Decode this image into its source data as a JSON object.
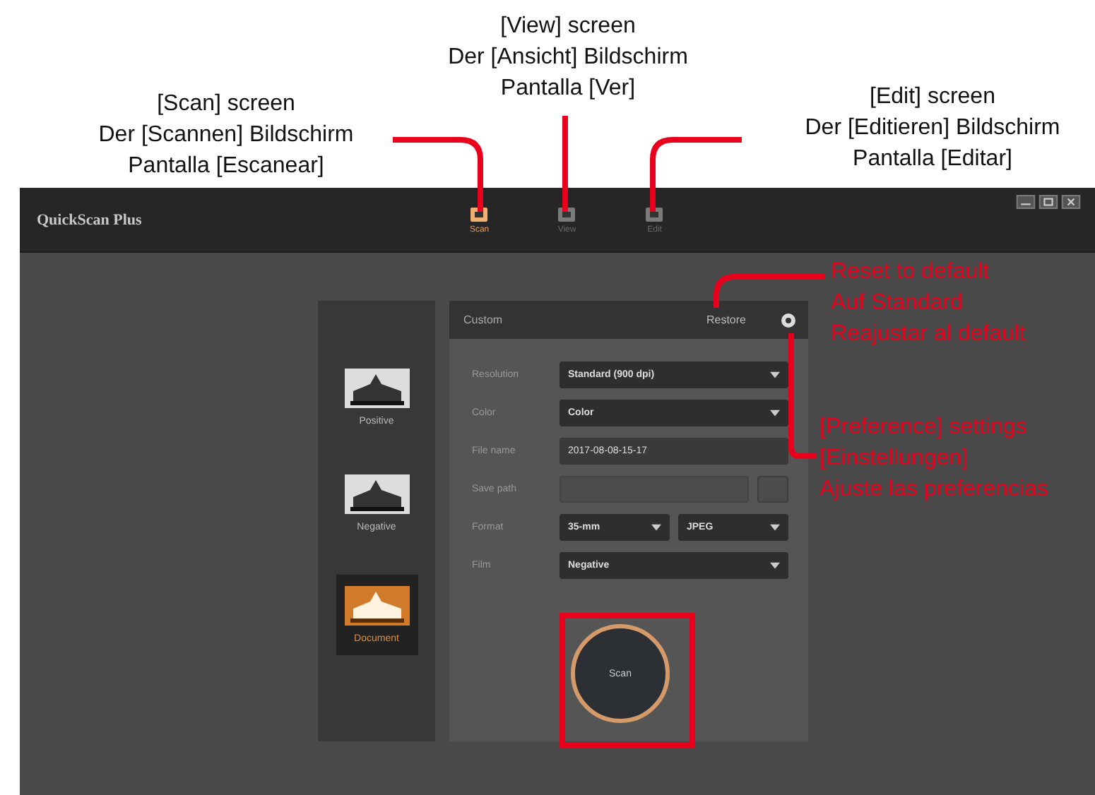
{
  "app": {
    "title": "QuickScan Plus"
  },
  "tabs": [
    {
      "label": "Scan",
      "selected": true
    },
    {
      "label": "View",
      "selected": false
    },
    {
      "label": "Edit",
      "selected": false
    }
  ],
  "film_types": [
    {
      "label": "Positive",
      "selected": false
    },
    {
      "label": "Negative",
      "selected": false
    },
    {
      "label": "Document",
      "selected": true
    }
  ],
  "settings": {
    "title": "Custom",
    "reset": "Restore",
    "rows": [
      {
        "label": "Resolution",
        "kind": "select",
        "value": "Standard (900 dpi)"
      },
      {
        "label": "Color",
        "kind": "select",
        "value": "Color"
      },
      {
        "label": "File name",
        "kind": "text",
        "value": "2017-08-08-15-17"
      },
      {
        "label": "Save path",
        "kind": "path"
      },
      {
        "label": "Format",
        "kind": "pair",
        "values": [
          "35-mm",
          "JPEG"
        ]
      },
      {
        "label": "Film",
        "kind": "select",
        "value": "Negative"
      }
    ],
    "scan_button": "Scan"
  },
  "annotations": [
    {
      "kind": "screen",
      "lines": [
        "[Scan] screen",
        "Der [Scannen] Bildschirm",
        "Pantalla [Escanear]"
      ]
    },
    {
      "kind": "screen",
      "lines": [
        "[View] screen",
        "Der [Ansicht] Bildschirm",
        "Pantalla [Ver]"
      ]
    },
    {
      "kind": "screen",
      "lines": [
        "[Edit] screen",
        "Der [Editieren] Bildschirm",
        "Pantalla [Editar]"
      ]
    },
    {
      "kind": "control",
      "lines": [
        "Reset to default",
        "Auf Standard",
        "Reajustar al default"
      ]
    },
    {
      "kind": "control",
      "lines": [
        "[Preference] settings",
        "[Einstellungen]",
        "Ajuste las preferencias"
      ]
    }
  ]
}
